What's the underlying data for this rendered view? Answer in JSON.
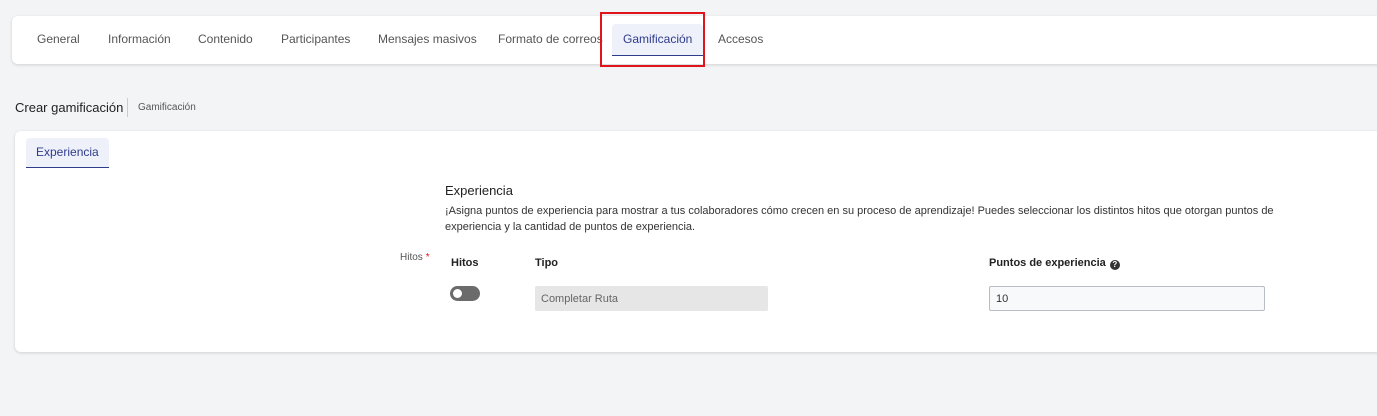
{
  "nav": {
    "tabs": [
      {
        "label": "General"
      },
      {
        "label": "Información"
      },
      {
        "label": "Contenido"
      },
      {
        "label": "Participantes"
      },
      {
        "label": "Mensajes masivos"
      },
      {
        "label": "Formato de correos"
      },
      {
        "label": "Gamificación",
        "active": true
      },
      {
        "label": "Accesos"
      }
    ]
  },
  "breadcrumb": {
    "title": "Crear gamificación",
    "sub": "Gamificación"
  },
  "panel": {
    "tab_label": "Experiencia",
    "section_title": "Experiencia",
    "section_desc": "¡Asigna puntos de experiencia para mostrar a tus colaboradores cómo crecen en su proceso de aprendizaje! Puedes seleccionar los distintos hitos que otorgan puntos de experiencia y la cantidad de puntos de experiencia.",
    "field_label": "Hitos",
    "required_mark": "*",
    "columns": {
      "hitos": "Hitos",
      "tipo": "Tipo",
      "puntos": "Puntos de experiencia"
    },
    "row": {
      "toggle_on": false,
      "tipo_value": "Completar Ruta",
      "puntos_value": "10"
    }
  },
  "icons": {
    "help": "question-circle-icon"
  },
  "colors": {
    "accent": "#2e3c8c",
    "highlight": "#e0141b",
    "required": "#e0141b"
  }
}
